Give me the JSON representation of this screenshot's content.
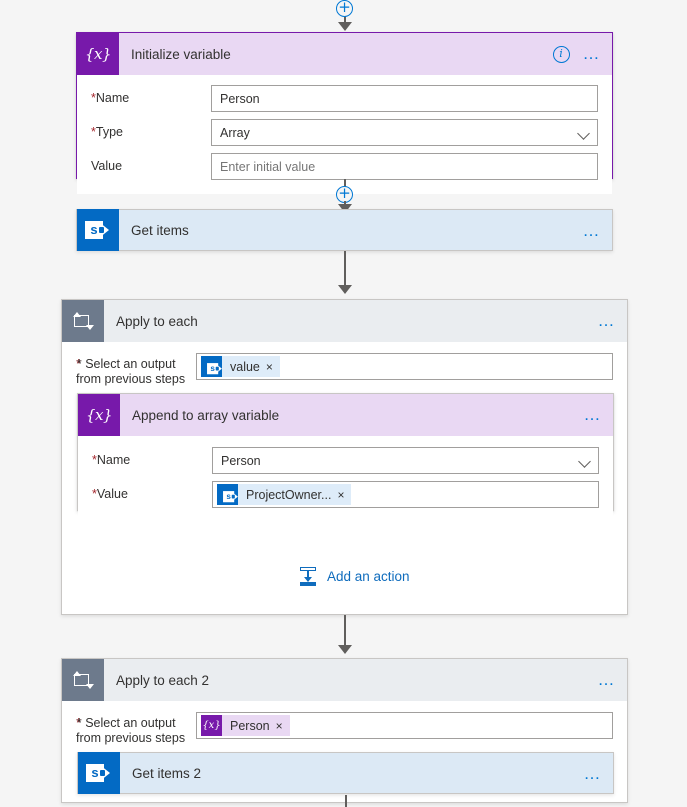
{
  "flow": {
    "steps": [
      {
        "id": "initialize-variable",
        "title": "Initialize variable",
        "icon": "variable-icon",
        "selected": true,
        "info_icon": "info-icon",
        "menu_icon": "ellipsis-icon",
        "fields": [
          {
            "label": "Name",
            "required": true,
            "value": "Person",
            "type": "text"
          },
          {
            "label": "Type",
            "required": true,
            "value": "Array",
            "type": "dropdown"
          },
          {
            "label": "Value",
            "required": false,
            "value": "",
            "placeholder": "Enter initial value",
            "type": "text"
          }
        ]
      },
      {
        "id": "get-items",
        "title": "Get items",
        "icon": "sharepoint-icon",
        "menu_icon": "ellipsis-icon"
      },
      {
        "id": "apply-to-each",
        "title": "Apply to each",
        "icon": "loop-icon",
        "menu_icon": "ellipsis-icon",
        "select_output_label_line1": "* Select an output",
        "select_output_label_line2": "from previous steps",
        "select_output_token": {
          "text": "value",
          "icon": "sharepoint-icon",
          "remove": "×"
        },
        "add_action_label": "Add an action",
        "add_action_icon": "add-action-icon",
        "child": {
          "id": "append-to-array-variable",
          "title": "Append to array variable",
          "icon": "variable-icon",
          "menu_icon": "ellipsis-icon",
          "fields": [
            {
              "label": "Name",
              "required": true,
              "value": "Person",
              "type": "dropdown"
            },
            {
              "label": "Value",
              "required": true,
              "type": "token",
              "token": {
                "text": "ProjectOwner...",
                "icon": "sharepoint-icon",
                "remove": "×"
              }
            }
          ]
        }
      },
      {
        "id": "apply-to-each-2",
        "title": "Apply to each 2",
        "icon": "loop-icon",
        "menu_icon": "ellipsis-icon",
        "select_output_label_line1": "* Select an output",
        "select_output_label_line2": "from previous steps",
        "select_output_token": {
          "text": "Person",
          "icon": "variable-icon",
          "remove": "×"
        },
        "child": {
          "id": "get-items-2",
          "title": "Get items 2",
          "icon": "sharepoint-icon",
          "menu_icon": "ellipsis-icon"
        }
      }
    ],
    "connectors": {
      "plus_label": "+",
      "required_marker": "*"
    },
    "glyphs": {
      "variable": "{x}",
      "sharepoint_letter": "s",
      "info": "i",
      "ellipsis": "• • •"
    },
    "colors": {
      "variable_purple": "#7719aa",
      "sharepoint_blue": "#036ac4",
      "loop_gray": "#6d7a8c",
      "accent_blue": "#0078d4",
      "link_blue": "#0f6cbd",
      "required_red": "#a4262c",
      "canvas_bg": "#f5f5f5"
    }
  }
}
